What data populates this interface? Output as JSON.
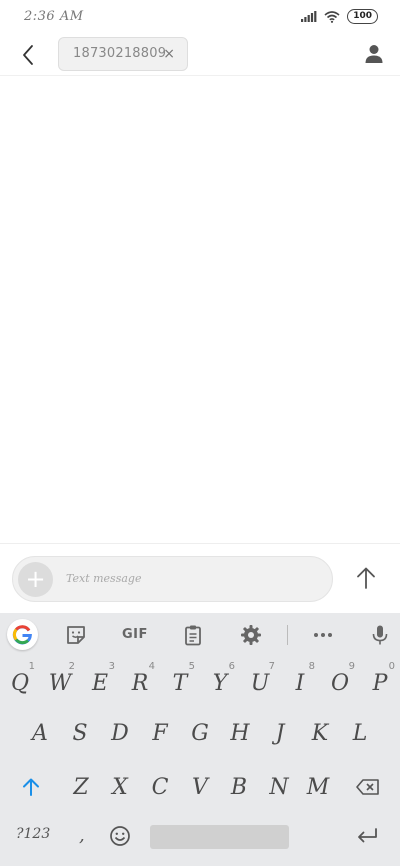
{
  "status": {
    "time": "2:36 AM",
    "battery": "100",
    "icons": [
      "signal-icon",
      "wifi-icon",
      "battery-icon"
    ]
  },
  "header": {
    "recipient": "18730218809",
    "close_glyph": "×",
    "icons": [
      "back-arrow-icon",
      "contact-person-icon"
    ]
  },
  "compose": {
    "placeholder": "Text message",
    "plus_glyph": "+",
    "icons": [
      "add-attachment-icon",
      "send-arrow-icon"
    ]
  },
  "keyboard": {
    "toolbar": {
      "gif_label": "GIF",
      "icons": [
        "google-g-icon",
        "sticker-icon",
        "clipboard-icon",
        "settings-gear-icon",
        "more-dots-icon",
        "microphone-icon"
      ]
    },
    "row1": [
      "Q",
      "W",
      "E",
      "R",
      "T",
      "Y",
      "U",
      "I",
      "O",
      "P"
    ],
    "row1_hints": [
      "1",
      "2",
      "3",
      "4",
      "5",
      "6",
      "7",
      "8",
      "9",
      "0"
    ],
    "row2": [
      "A",
      "S",
      "D",
      "F",
      "G",
      "H",
      "J",
      "K",
      "L"
    ],
    "row3": [
      "Z",
      "X",
      "C",
      "V",
      "B",
      "N",
      "M"
    ],
    "symbols_label": "?123",
    "comma": ",",
    "accent_color": "#1a8fe8"
  }
}
